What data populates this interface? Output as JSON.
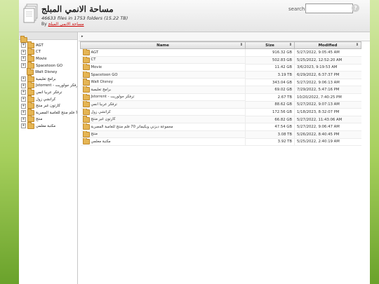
{
  "header": {
    "title": "مساحة الانمي المبلج",
    "subtitle": "46633 files in 1753 folders (15.22 TB)",
    "by_label": "By",
    "by_link": "مساحة الانمي المبلج",
    "search_label": "search:",
    "search_value": "",
    "help_glyph": "?"
  },
  "tree": {
    "items": [
      {
        "label": "AGT",
        "expandable": true
      },
      {
        "label": "CT",
        "expandable": true
      },
      {
        "label": "Movie",
        "expandable": true
      },
      {
        "label": "Spacetoon GO",
        "expandable": true
      },
      {
        "label": "Walt Disney",
        "expandable": false
      },
      {
        "label": "برامج تعليمية",
        "expandable": true
      },
      {
        "label": "Jstorrent - ترفكر جولوريت",
        "expandable": true
      },
      {
        "label": "ترفكر عربيا انمي",
        "expandable": true
      },
      {
        "label": "كراتشي زول",
        "expandable": true
      },
      {
        "label": "كارتون غير منتج",
        "expandable": true
      },
      {
        "label": "ويكيماتر 70 فلم منتج للعامية المصرية",
        "expandable": true
      },
      {
        "label": "منتج",
        "expandable": true
      },
      {
        "label": "مكتبة معلمي",
        "expandable": true
      }
    ]
  },
  "breadcrumb": "▸",
  "table": {
    "columns": {
      "name": "Name",
      "size": "Size",
      "modified": "Modified"
    },
    "sort_glyph": "⇕",
    "rows": [
      {
        "name": "AGT",
        "size": "916.32 GB",
        "modified": "5/27/2022, 9:05:45 AM"
      },
      {
        "name": "CT",
        "size": "502.83 GB",
        "modified": "5/25/2022, 12:52:20 AM"
      },
      {
        "name": "Movie",
        "size": "11.42 GB",
        "modified": "3/6/2023, 9:19:53 AM"
      },
      {
        "name": "Spacetoon GO",
        "size": "3.19 TB",
        "modified": "6/29/2022, 6:37:37 PM"
      },
      {
        "name": "Walt Disney",
        "size": "343.04 GB",
        "modified": "5/27/2022, 9:06:13 AM"
      },
      {
        "name": "برامج تعليمية",
        "size": "69.02 GB",
        "modified": "7/29/2022, 5:47:16 PM"
      },
      {
        "name": "Jstorrent - ترفكر جولوريت",
        "size": "2.67 TB",
        "modified": "10/20/2022, 7:40:25 PM"
      },
      {
        "name": "ترفكر عربيا انمي",
        "size": "88.62 GB",
        "modified": "5/27/2022, 9:07:13 AM"
      },
      {
        "name": "كراتشي زول",
        "size": "172.56 GB",
        "modified": "1/18/2023, 8:32:07 PM"
      },
      {
        "name": "كارتون غير منتج",
        "size": "66.82 GB",
        "modified": "5/27/2022, 11:43:06 AM"
      },
      {
        "name": "مجموعة ديزني ويكيماتر 70 فلم منتج للعامية المصرية",
        "size": "47.54 GB",
        "modified": "5/27/2022, 9:06:47 AM"
      },
      {
        "name": "منتج",
        "size": "3.08 TB",
        "modified": "5/26/2022, 8:40:45 PM"
      },
      {
        "name": "مكتبة معلمي",
        "size": "3.92 TB",
        "modified": "5/25/2022, 2:40:19 AM"
      }
    ]
  }
}
